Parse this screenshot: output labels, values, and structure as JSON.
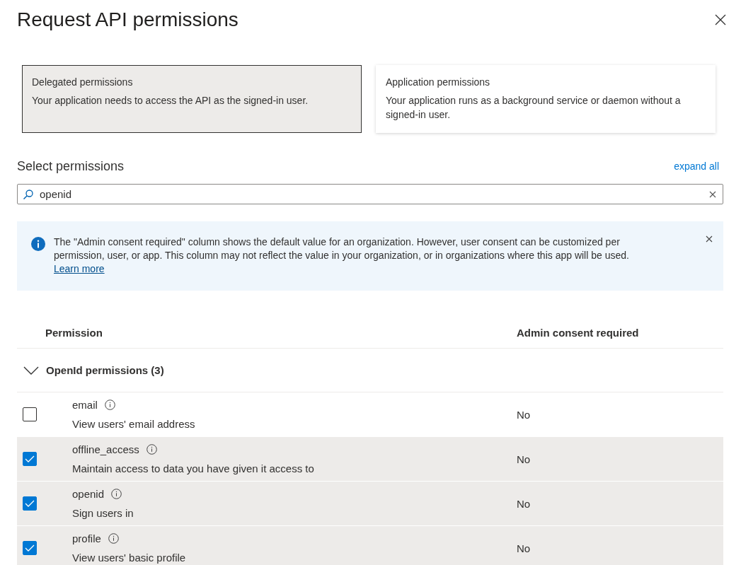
{
  "panel": {
    "title": "Request API permissions"
  },
  "permission_types": [
    {
      "title": "Delegated permissions",
      "description": "Your application needs to access the API as the signed-in user.",
      "selected": true
    },
    {
      "title": "Application permissions",
      "description": "Your application runs as a background service or daemon without a signed-in user.",
      "selected": false
    }
  ],
  "select_heading": "Select permissions",
  "expand_all": "expand all",
  "search": {
    "value": "openid"
  },
  "info_banner": {
    "message": "The \"Admin consent required\" column shows the default value for an organization. However, user consent can be customized per permission, user, or app. This column may not reflect the value in your organization, or in organizations where this app will be used.",
    "link": "Learn more"
  },
  "table": {
    "columns": [
      "Permission",
      "Admin consent required"
    ],
    "groups": [
      {
        "label": "OpenId permissions (3)",
        "expanded": true,
        "rows": [
          {
            "name": "email",
            "description": "View users' email address",
            "admin_consent": "No",
            "checked": false
          },
          {
            "name": "offline_access",
            "description": "Maintain access to data you have given it access to",
            "admin_consent": "No",
            "checked": true
          },
          {
            "name": "openid",
            "description": "Sign users in",
            "admin_consent": "No",
            "checked": true
          },
          {
            "name": "profile",
            "description": "View users' basic profile",
            "admin_consent": "No",
            "checked": true
          }
        ]
      }
    ]
  }
}
